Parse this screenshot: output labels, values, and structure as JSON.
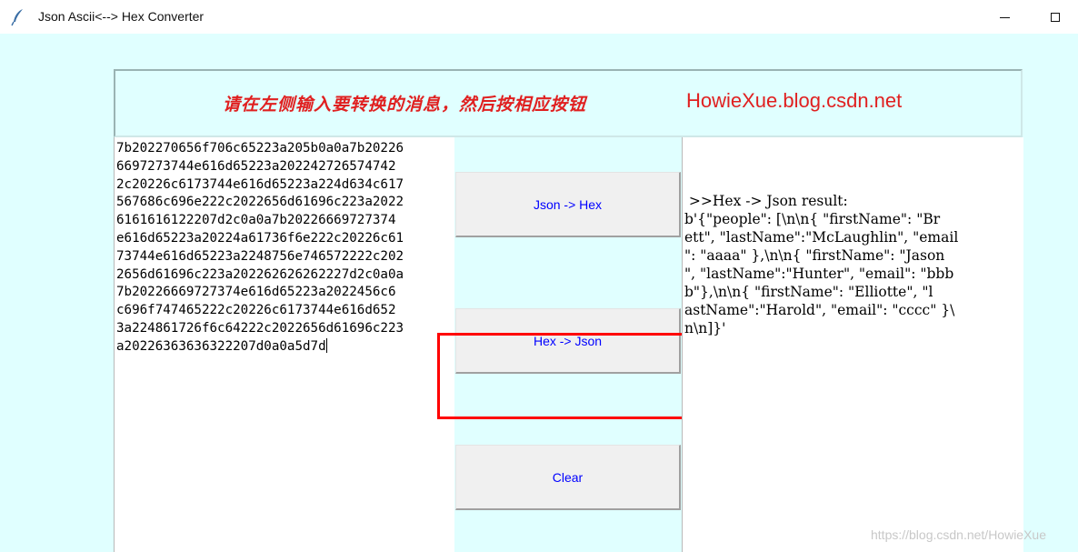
{
  "window": {
    "title": "Json Ascii<--> Hex Converter",
    "icon": "feather-icon"
  },
  "banner": {
    "instruction": "请在左侧输入要转换的消息，然后按相应按钮",
    "site": "HowieXue.blog.csdn.net",
    "text_color": "#e02020"
  },
  "input": {
    "lines": [
      "7b202270656f706c65223a205b0a0a7b20226",
      "6697273744e616d65223a202242726574742",
      "2c20226c6173744e616d65223a224d634c617",
      "567686c696e222c2022656d61696c223a2022",
      "6161616122207d2c0a0a7b20226669727374",
      "e616d65223a20224a61736f6e222c20226c61",
      "73744e616d65223a2248756e746572222c202",
      "2656d61696c223a202262626262227d2c0a0a",
      "7b20226669727374e616d65223a2022456c6",
      "c696f747465222c20226c6173744e616d652",
      "3a224861726f6c64222c2022656d61696c223",
      "a20226363636322207d0a0a5d7d"
    ]
  },
  "buttons": {
    "json_to_hex": "Json -> Hex",
    "hex_to_json": "Hex -> Json",
    "clear": "Clear",
    "label_color": "#0000ff"
  },
  "result": {
    "lines": [
      " >>Hex -> Json result:",
      "b'{\"people\": [\\n\\n{ \"firstName\": \"Br",
      "ett\", \"lastName\":\"McLaughlin\", \"email",
      "\": \"aaaa\" },\\n\\n{ \"firstName\": \"Jason",
      "\", \"lastName\":\"Hunter\", \"email\": \"bbb",
      "b\"},\\n\\n{ \"firstName\": \"Elliotte\", \"l",
      "astName\":\"Harold\", \"email\": \"cccc\" }\\",
      "n\\n]}'"
    ]
  },
  "watermark": "https://blog.csdn.net/HowieXue",
  "colors": {
    "background": "#e0ffff",
    "highlight": "#ff0000"
  }
}
